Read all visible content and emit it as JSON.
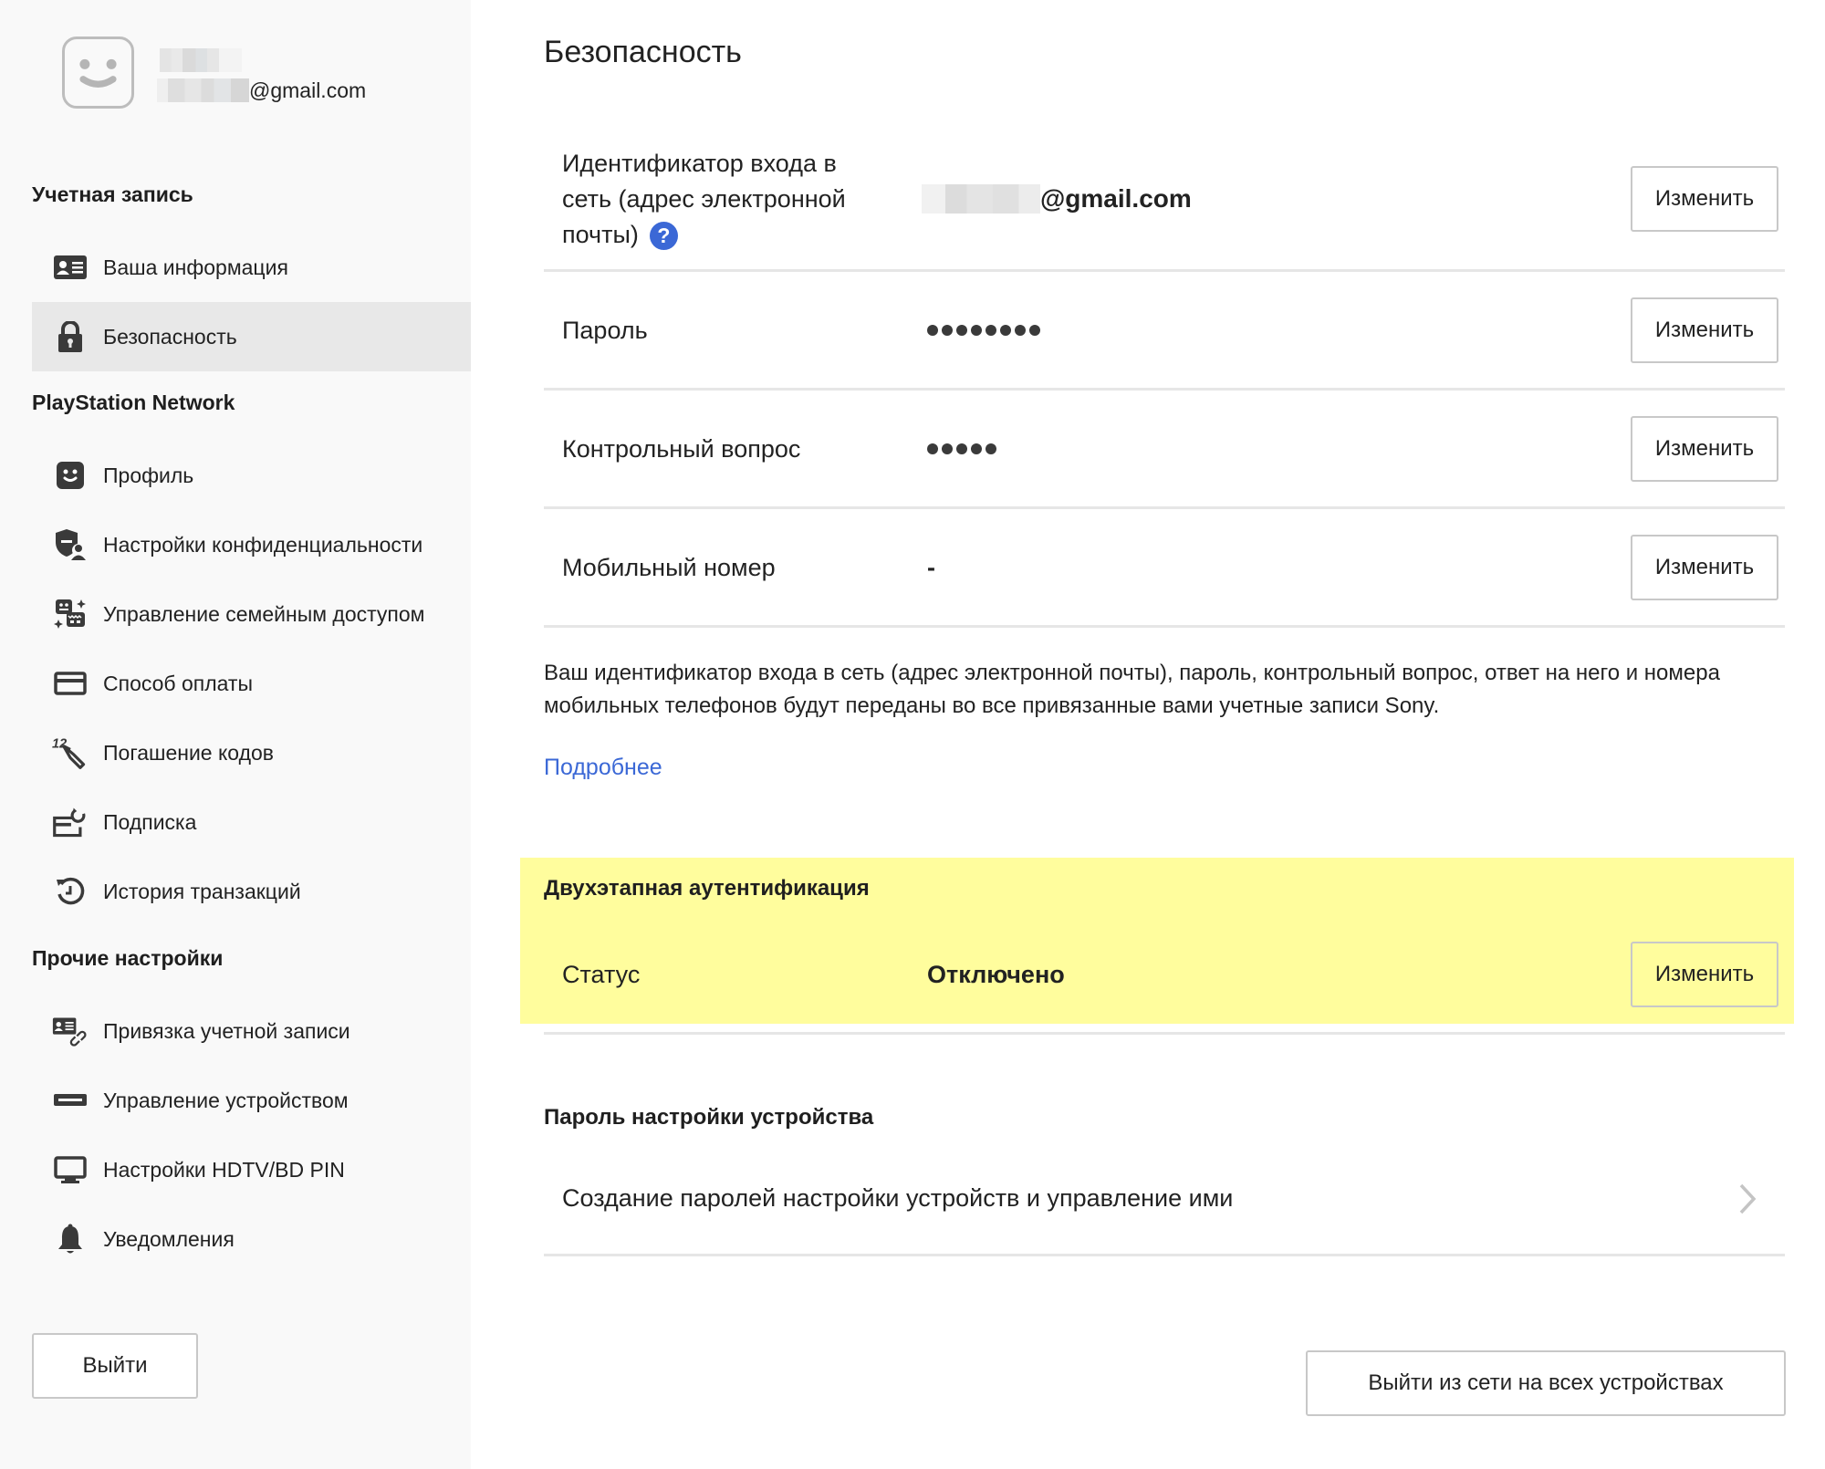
{
  "user": {
    "email_suffix": "@gmail.com"
  },
  "sidebar": {
    "sections": [
      {
        "heading": "Учетная запись"
      },
      {
        "heading": "PlayStation Network"
      },
      {
        "heading": "Прочие настройки"
      }
    ],
    "items": [
      {
        "label": "Ваша информация",
        "icon": "id-card-icon"
      },
      {
        "label": "Безопасность",
        "icon": "lock-icon",
        "active": true
      },
      {
        "label": "Профиль",
        "icon": "profile-face-icon"
      },
      {
        "label": "Настройки конфиденциальности",
        "icon": "privacy-shield-icon"
      },
      {
        "label": "Управление семейным доступом",
        "icon": "family-icon"
      },
      {
        "label": "Способ оплаты",
        "icon": "credit-card-icon"
      },
      {
        "label": "Погашение кодов",
        "icon": "redeem-code-icon"
      },
      {
        "label": "Подписка",
        "icon": "subscription-icon"
      },
      {
        "label": "История транзакций",
        "icon": "history-icon"
      },
      {
        "label": "Привязка учетной записи",
        "icon": "account-link-icon"
      },
      {
        "label": "Управление устройством",
        "icon": "device-icon"
      },
      {
        "label": "Настройки HDTV/BD PIN",
        "icon": "tv-icon"
      },
      {
        "label": "Уведомления",
        "icon": "bell-icon"
      }
    ],
    "logout_label": "Выйти"
  },
  "main": {
    "title": "Безопасность",
    "rows": [
      {
        "label": "Идентификатор входа в сеть (адрес электронной почты)",
        "value_suffix": "@gmail.com",
        "button": "Изменить"
      },
      {
        "label": "Пароль",
        "masked_length": 8,
        "button": "Изменить"
      },
      {
        "label": "Контрольный вопрос",
        "masked_length": 5,
        "button": "Изменить"
      },
      {
        "label": "Мобильный номер",
        "value": "-",
        "button": "Изменить"
      }
    ],
    "description": "Ваш идентификатор входа в сеть (адрес электронной почты), пароль, контрольный вопрос, ответ на него и номера мобильных телефонов будут переданы во все привязанные вами учетные записи Sony.",
    "more_link": "Подробнее",
    "two_factor": {
      "title": "Двухэтапная аутентификация",
      "status_label": "Статус",
      "status_value": "Отключено",
      "button": "Изменить",
      "highlight_color": "#fffd9d"
    },
    "device_password": {
      "title": "Пароль настройки устройства",
      "item_label": "Создание паролей настройки устройств и управление ими"
    },
    "logout_all_label": "Выйти из сети на всех устройствах"
  },
  "colors": {
    "link": "#3b68d6",
    "sidebar_bg": "#f9f9f9",
    "sidebar_active": "#e8e8e8"
  }
}
